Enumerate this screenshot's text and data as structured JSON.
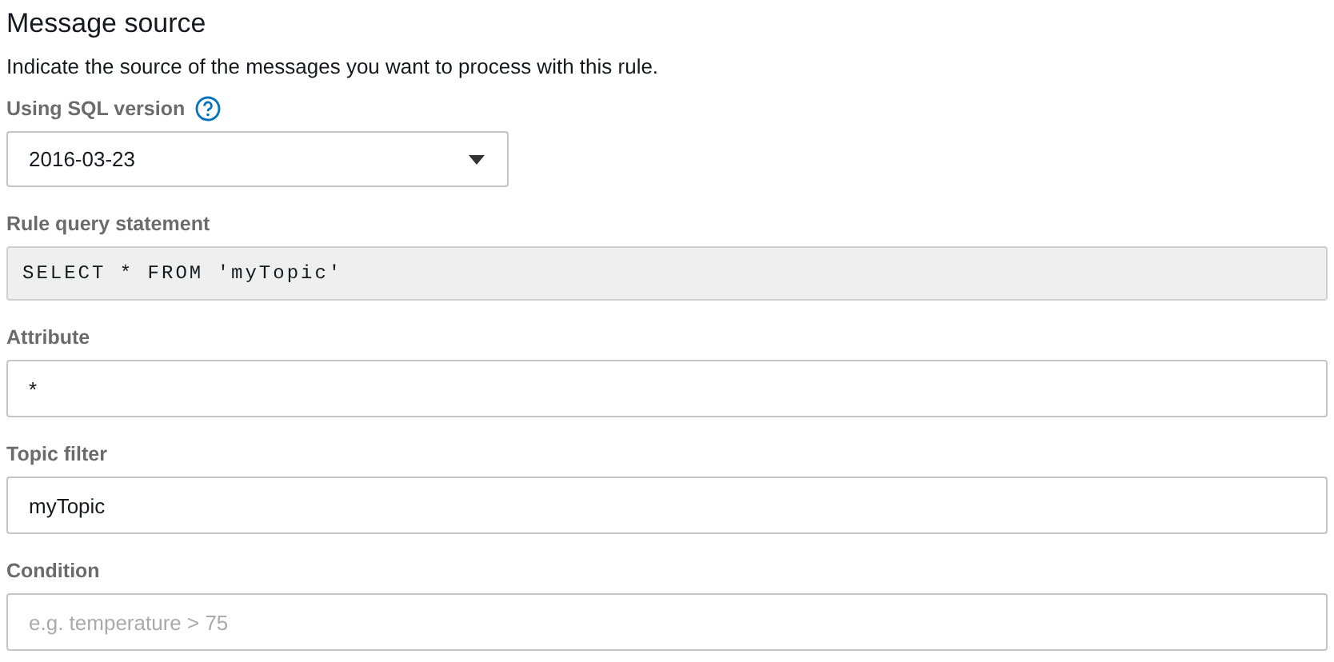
{
  "section": {
    "title": "Message source",
    "description": "Indicate the source of the messages you want to process with this rule."
  },
  "fields": [
    {
      "kind": "select",
      "label": "Using SQL version",
      "help": true,
      "value": "2016-03-23"
    },
    {
      "kind": "readonly",
      "label": "Rule query statement",
      "value": "SELECT * FROM 'myTopic'"
    },
    {
      "kind": "input",
      "label": "Attribute",
      "value": "*"
    },
    {
      "kind": "input",
      "label": "Topic filter",
      "value": "myTopic"
    },
    {
      "kind": "input",
      "label": "Condition",
      "placeholder": "e.g. temperature > 75"
    }
  ]
}
